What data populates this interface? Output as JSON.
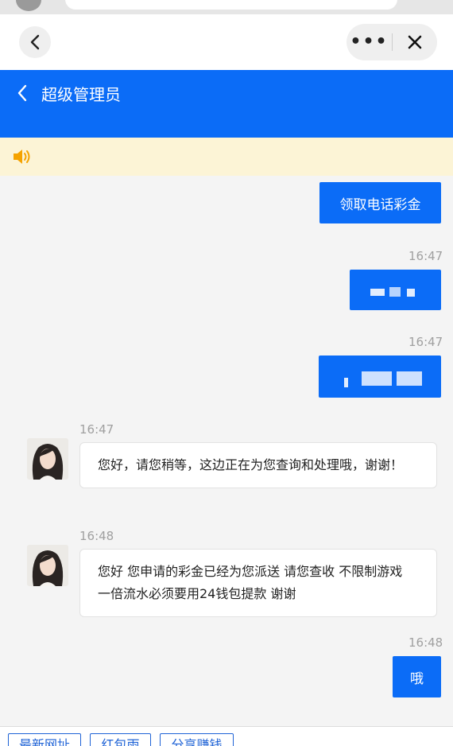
{
  "header": {
    "title": "超级管理员"
  },
  "messages": {
    "m1_text": "领取电话彩金",
    "m2_time": "16:47",
    "m3_time": "16:47",
    "m4_time": "16:47",
    "m4_text": "您好，请您稍等，这边正在为您查询和处理哦，谢谢！",
    "m5_time": "16:48",
    "m5_text": "您好 您申请的彩金已经为您派送 请您查收 不限制游戏 一倍流水必须要用24钱包提款 谢谢",
    "m6_time": "16:48",
    "m6_text": "哦"
  },
  "bottom_tabs": [
    "最新网址",
    "红包雨",
    "分享赚钱"
  ],
  "colors": {
    "brand_blue": "#0b6cf7",
    "notice_bg": "#fcf4d6",
    "tab_blue": "#1f63d6"
  },
  "icons": [
    "back-chevron-icon",
    "more-icon",
    "close-icon",
    "speaker-icon",
    "avatar"
  ]
}
